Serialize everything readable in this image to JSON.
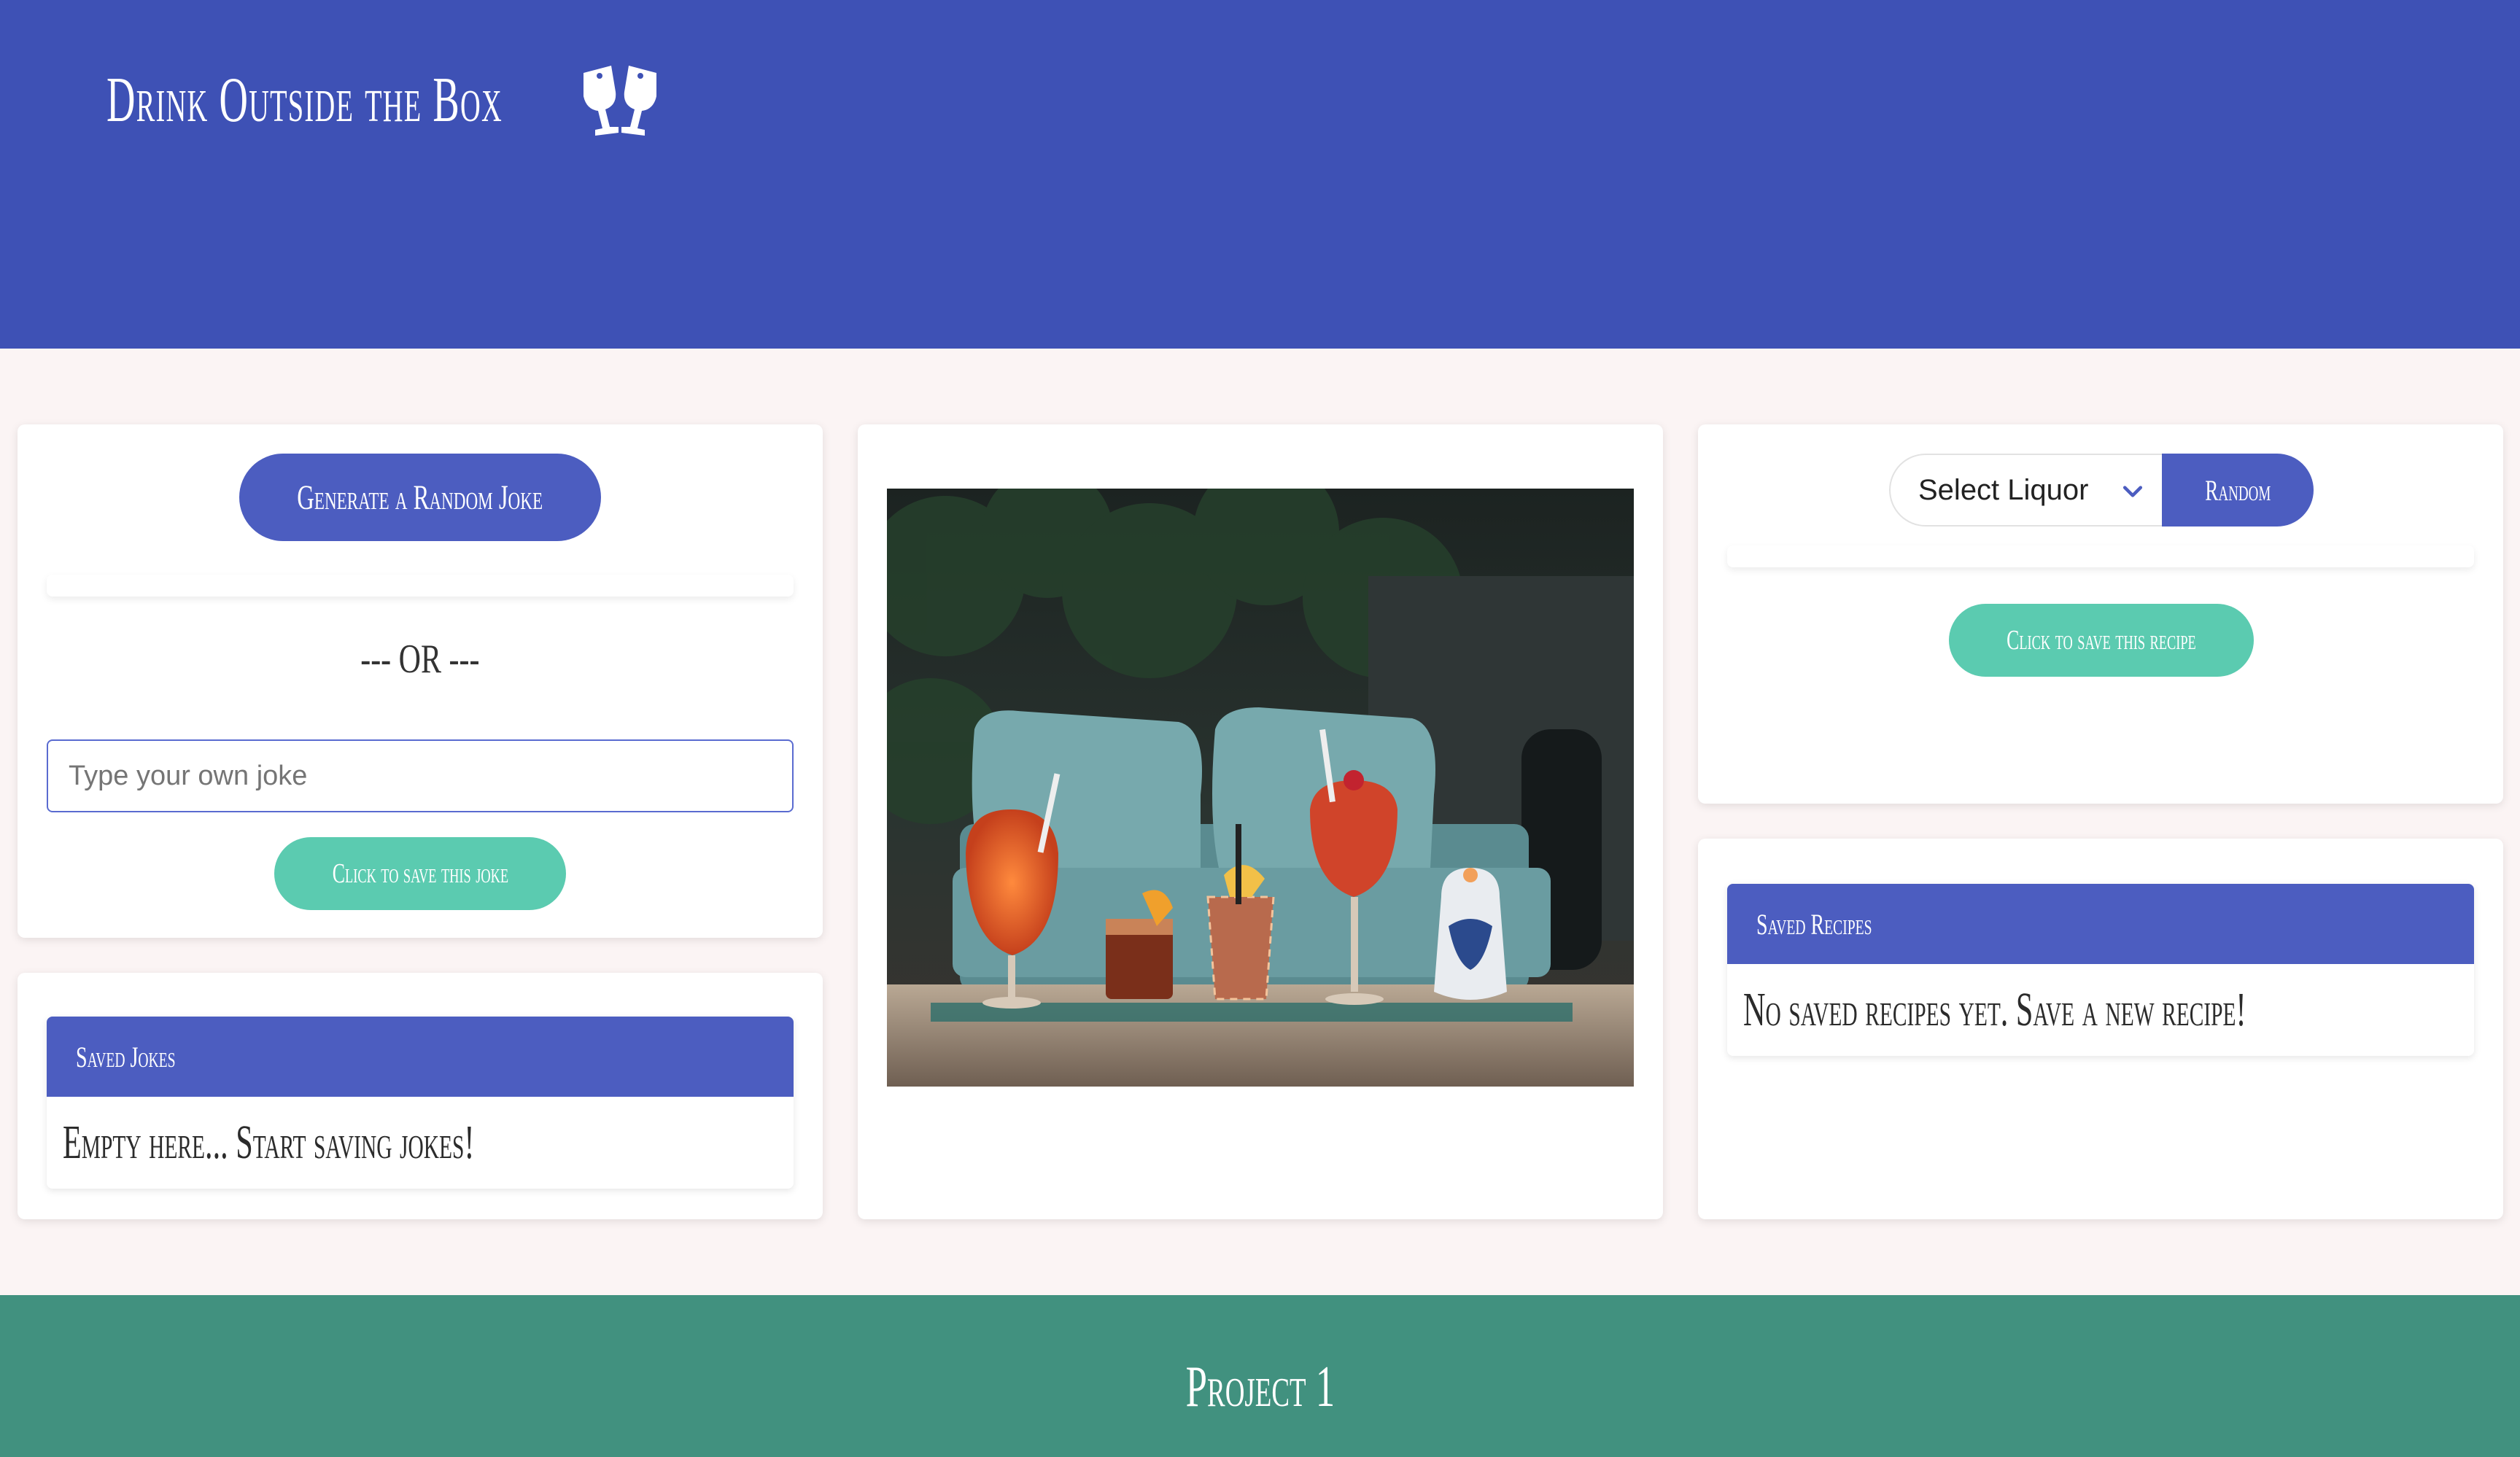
{
  "header": {
    "title": "Drink Outside the Box",
    "icon": "clinking-glasses-icon"
  },
  "jokes": {
    "generate_label": "Generate a Random Joke",
    "or_label": "--- OR ---",
    "input_placeholder": "Type your own joke",
    "input_value": "",
    "save_label": "Click to save this joke"
  },
  "saved_jokes": {
    "title": "Saved Jokes",
    "empty_text": "Empty here... Start saving jokes!"
  },
  "photo": {
    "icon": "cocktails-photo"
  },
  "recipes": {
    "select_label": "Select Liquor",
    "random_label": "Random",
    "save_label": "Click to save this recipe"
  },
  "saved_recipes": {
    "title": "Saved Recipes",
    "empty_text": "No saved recipes yet. Save a new recipe!"
  },
  "footer": {
    "text": "Project 1"
  },
  "colors": {
    "header": "#3e51b5",
    "primary_button": "#4c5dc0",
    "accent_button": "#5bcbb0",
    "footer": "#41917f",
    "page_bg": "#fbf4f4"
  }
}
